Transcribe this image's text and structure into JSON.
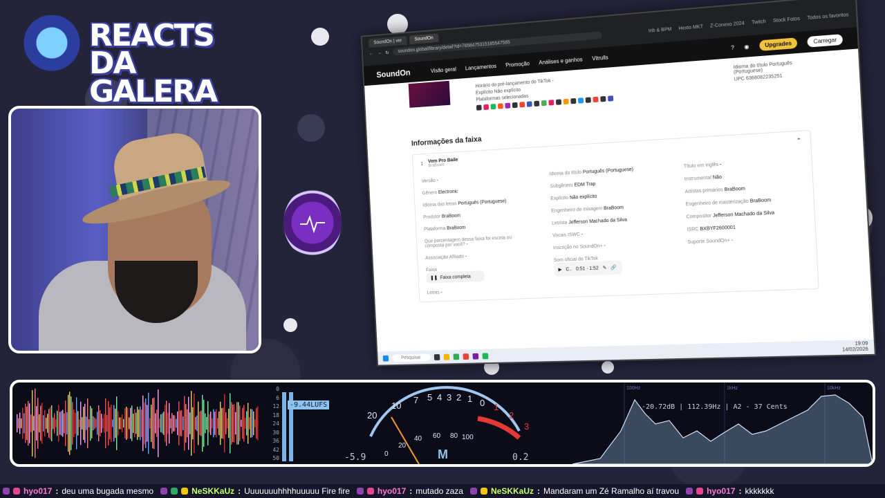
{
  "logo": {
    "line1": "REACTS",
    "line2": "DA GALERA"
  },
  "browser": {
    "tabs": [
      "SoundOn | ver",
      "SoundOn"
    ],
    "url": "soundon.global/library/detail?id=7658475315185547585",
    "bookmarks": [
      "Inb & BPM",
      "Todos os favoritos",
      "Hexto MKT",
      "Z-Conexo 2024",
      "Twitch",
      "Stock Fotos"
    ]
  },
  "app": {
    "brand": "SoundOn",
    "nav": [
      "Visão geral",
      "Lançamentos",
      "Promoção",
      "Análises e ganhos",
      "Vitrulls"
    ],
    "upgrade_label": "Upgrades",
    "upload_label": "Carregar"
  },
  "release_meta": {
    "left": [
      "Horário do pré-lançamento do TikTok -",
      "Explícito Não explícito",
      "Plataformas selecionadas"
    ],
    "right": [
      "Idioma do título Português (Portuguese)",
      "UPC 6368082235251"
    ]
  },
  "track_section": {
    "title": "Informações da faixa",
    "track_name": "Vem Pro Baile",
    "track_artist": "BraBoom",
    "col1": [
      {
        "k": "Versão",
        "v": "-"
      },
      {
        "k": "Gênero",
        "v": "Electronic"
      },
      {
        "k": "Idioma das letras",
        "v": "Português (Portuguese)"
      },
      {
        "k": "Produtor",
        "v": "BraBoom"
      },
      {
        "k": "Plataforma",
        "v": "BraBoom"
      },
      {
        "k": "Que porcentagem dessa faixa foi escrita ou composta por você?",
        "v": "-"
      },
      {
        "k": "Associação Afiliado",
        "v": "-"
      },
      {
        "k": "Faixa",
        "v": ""
      },
      {
        "k": "Letras",
        "v": "-"
      }
    ],
    "col2": [
      {
        "k": "Idioma do título",
        "v": "Português (Portuguese)"
      },
      {
        "k": "Subgênero",
        "v": "EDM Trap"
      },
      {
        "k": "Explícito",
        "v": "Não explícito"
      },
      {
        "k": "Engenheiro de mixagem",
        "v": "BraBoom"
      },
      {
        "k": "Letrista",
        "v": "Jefferson Machado da Silva"
      },
      {
        "k": "Vocais ISWC",
        "v": "-"
      },
      {
        "k": "Inscrição no SoundOn+",
        "v": "-"
      },
      {
        "k": "Som oficial do TikTok",
        "v": ""
      }
    ],
    "col3": [
      {
        "k": "Título em inglês",
        "v": "-"
      },
      {
        "k": "Instrumental",
        "v": "Não"
      },
      {
        "k": "Artistas primários",
        "v": "BraBoom"
      },
      {
        "k": "Engenheiro de masterização",
        "v": "BraBoom"
      },
      {
        "k": "Compositor",
        "v": "Jefferson Machado da Silva"
      },
      {
        "k": "ISRC",
        "v": "BXBYF2600001"
      },
      {
        "k": "Suporte SoundOn+",
        "v": "-"
      }
    ],
    "faixa_pill": "Faixa completa",
    "player": {
      "label": "C..",
      "time": "0:51 · 1:52"
    }
  },
  "taskbar": {
    "search": "Pesquisar",
    "time": "19:09",
    "date": "14/02/2026"
  },
  "meter": {
    "lufs": "-9.44LUFS",
    "loud_scale": [
      "0",
      "6",
      "12",
      "18",
      "24",
      "30",
      "36",
      "42",
      "48",
      "50"
    ],
    "vu_left_value": "-5.9",
    "vu_right_value": "0.2",
    "vu_mode": "M",
    "vu_scale_top": [
      "20",
      "10",
      "7",
      "5",
      "4",
      "3",
      "2",
      "1",
      "0",
      "1",
      "2",
      "3"
    ],
    "vu_scale_bottom": [
      "0",
      "20",
      "40",
      "60",
      "80",
      "100"
    ],
    "spec_readout": "-20.72dB | 112.39Hz | A2 - 37 Cents",
    "spec_freqs": [
      "100Hz",
      "1kHz",
      "10kHz"
    ],
    "colors": {
      "accent_red": "#e53935",
      "accent_blue": "#8ec3f0"
    }
  },
  "chat": [
    {
      "user": "hyo017",
      "color": "pink",
      "text": "deu uma bugada mesmo"
    },
    {
      "user": "NeSKKaUz",
      "color": "green",
      "text": "Uuuuuuuhhhhuuuuu  Fire fire"
    },
    {
      "user": "hyo017",
      "color": "pink",
      "text": "mutado zaza"
    },
    {
      "user": "NeSKKaUz",
      "color": "green",
      "text": "Mandaram um Zé Ramalho aí travou"
    },
    {
      "user": "hyo017",
      "color": "pink",
      "text": "kkkkkkk"
    }
  ]
}
